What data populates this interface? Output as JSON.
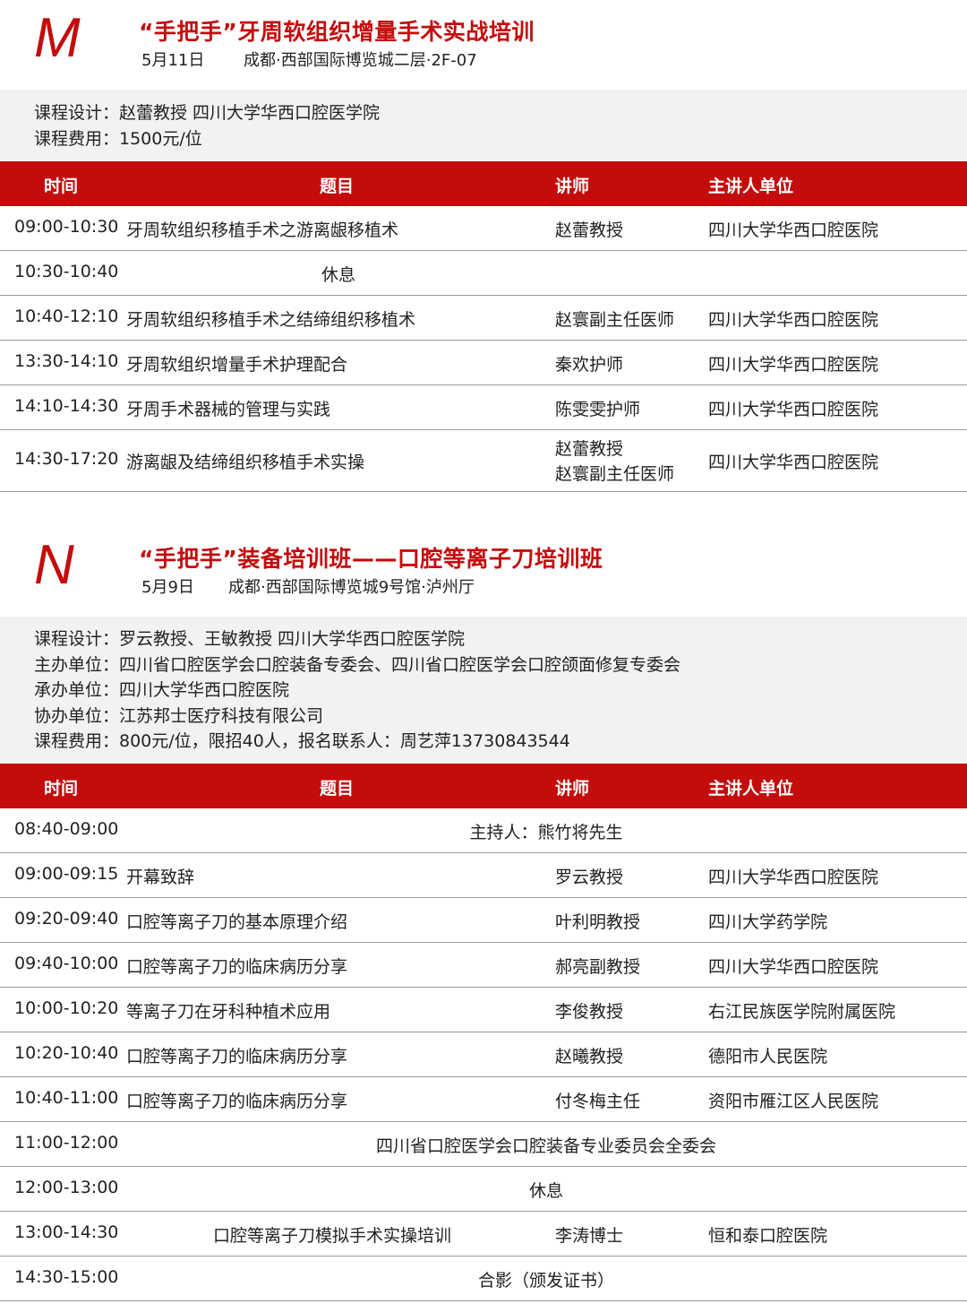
{
  "sections": [
    {
      "letter": "M",
      "title": "“手把手”牙周软组织增量手术实战培训",
      "date": "5月11日",
      "venue": "成都·西部国际博览城二层·2F-07",
      "info_lines": [
        "课程设计：赵蕾教授      四川大学华西口腔医学院",
        "课程费用：1500元/位"
      ],
      "headers": [
        "时间",
        "题目",
        "讲师",
        "主讲人单位"
      ],
      "rows": [
        {
          "time": "09:00-10:30",
          "topic": "牙周软组织移植手术之游离龈移植术",
          "speaker": "赵蕾教授",
          "unit": "四川大学华西口腔医院"
        },
        {
          "time": "10:30-10:40",
          "topic": "休息"
        },
        {
          "time": "10:40-12:10",
          "topic": "牙周软组织移植手术之结缔组织移植术",
          "speaker": "赵寰副主任医师",
          "unit": "四川大学华西口腔医院"
        },
        {
          "time": "13:30-14:10",
          "topic": "牙周软组织增量手术护理配合",
          "speaker": "秦欢护师",
          "unit": "四川大学华西口腔医院"
        },
        {
          "time": "14:10-14:30",
          "topic": "牙周手术器械的管理与实践",
          "speaker": "陈雯雯护师",
          "unit": "四川大学华西口腔医院"
        },
        {
          "time": "14:30-17:20",
          "topic": "游离龈及结缔组织移植手术实操",
          "speaker": "赵蕾教授",
          "speaker_2": "赵寰副主任医师",
          "unit": "四川大学华西口腔医院"
        }
      ]
    },
    {
      "letter": "N",
      "title": "“手把手”装备培训班——口腔等离子刀培训班",
      "date": "5月9日",
      "venue": "成都·西部国际博览城9号馆·泸州厅",
      "info_lines": [
        "课程设计：罗云教授、王敏教授      四川大学华西口腔医学院",
        "主办单位：四川省口腔医学会口腔装备专委会、四川省口腔医学会口腔颌面修复专委会",
        "承办单位：四川大学华西口腔医院",
        "协办单位：江苏邦士医疗科技有限公司",
        "课程费用：800元/位，限招40人，报名联系人：周艺萍13730843544"
      ],
      "headers": [
        "时间",
        "题目",
        "讲师",
        "主讲人单位"
      ],
      "rows": [
        {
          "time": "08:40-09:00",
          "topic": "主持人：熊竹将先生"
        },
        {
          "time": "09:00-09:15",
          "topic": "开幕致辞",
          "speaker": "罗云教授",
          "unit": "四川大学华西口腔医院"
        },
        {
          "time": "09:20-09:40",
          "topic": "口腔等离子刀的基本原理介绍",
          "speaker": "叶利明教授",
          "unit": "四川大学药学院"
        },
        {
          "time": "09:40-10:00",
          "topic": "口腔等离子刀的临床病历分享",
          "speaker": "郝亮副教授",
          "unit": "四川大学华西口腔医院"
        },
        {
          "time": "10:00-10:20",
          "topic": "等离子刀在牙科种植术应用",
          "speaker": "李俊教授",
          "unit": "右江民族医学院附属医院"
        },
        {
          "time": "10:20-10:40",
          "topic": "口腔等离子刀的临床病历分享",
          "speaker": "赵曦教授",
          "unit": "德阳市人民医院"
        },
        {
          "time": "10:40-11:00",
          "topic": "口腔等离子刀的临床病历分享",
          "speaker": "付冬梅主任",
          "unit": "资阳市雁江区人民医院"
        },
        {
          "time": "11:00-12:00",
          "topic": "四川省口腔医学会口腔装备专业委员会全委会"
        },
        {
          "time": "12:00-13:00",
          "topic": "休息"
        },
        {
          "time": "13:00-14:30",
          "topic": "口腔等离子刀模拟手术实操培训",
          "speaker": "李涛博士",
          "unit": "恒和泰口腔医院"
        },
        {
          "time": "14:30-15:00",
          "topic": "合影（颁发证书）"
        }
      ]
    }
  ]
}
